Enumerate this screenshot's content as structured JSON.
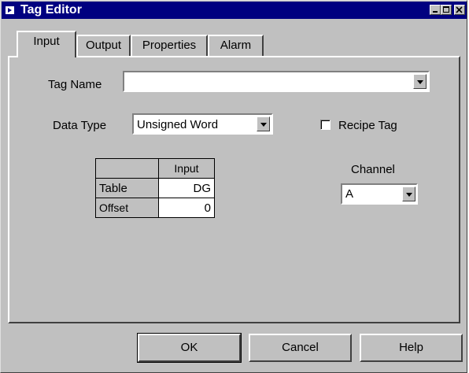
{
  "window": {
    "title": "Tag Editor"
  },
  "tabs": [
    {
      "label": "Input",
      "active": true
    },
    {
      "label": "Output",
      "active": false
    },
    {
      "label": "Properties",
      "active": false
    },
    {
      "label": "Alarm",
      "active": false
    }
  ],
  "form": {
    "tag_name_label": "Tag Name",
    "tag_name_value": "",
    "data_type_label": "Data Type",
    "data_type_value": "Unsigned Word",
    "recipe_tag_label": "Recipe Tag",
    "recipe_tag_checked": false,
    "channel_label": "Channel",
    "channel_value": "A"
  },
  "table": {
    "column_header": "Input",
    "rows": [
      {
        "label": "Table",
        "value": "DG"
      },
      {
        "label": "Offset",
        "value": "0"
      }
    ]
  },
  "buttons": {
    "ok": "OK",
    "cancel": "Cancel",
    "help": "Help"
  },
  "icons": {
    "window": "window-icon",
    "minimize": "minimize-icon",
    "maximize": "maximize-icon",
    "close": "close-icon",
    "dropdown": "chevron-down-icon"
  },
  "colors": {
    "titlebar": "#000080",
    "face": "#c0c0c0"
  }
}
